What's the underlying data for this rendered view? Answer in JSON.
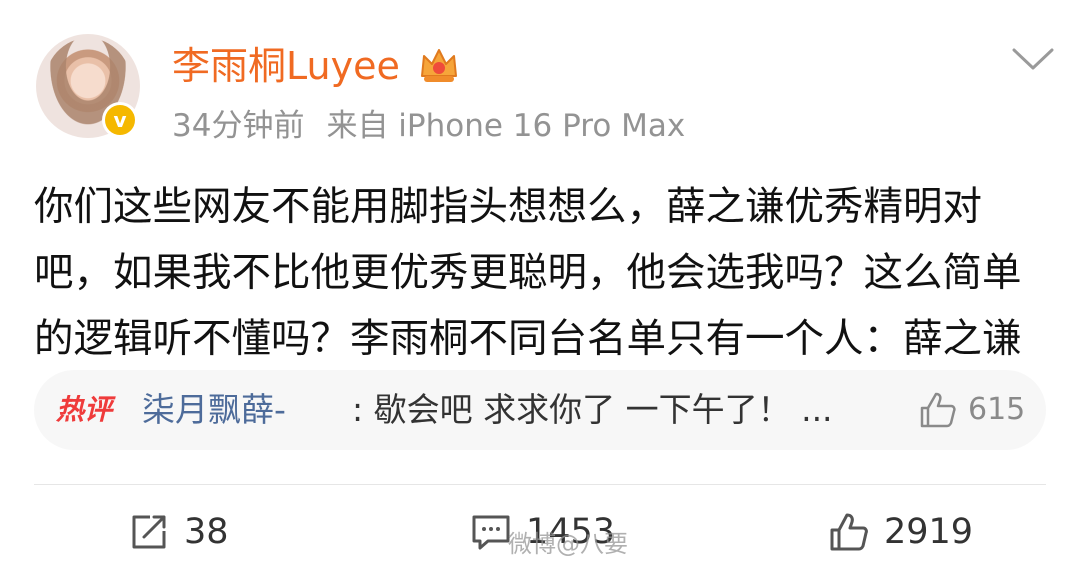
{
  "post": {
    "author": "李雨桐Luyee",
    "time": "34分钟前",
    "source": "来自 iPhone 16 Pro Max",
    "content_lines": [
      "你们这些网友不能用脚指头想想么，薛之谦优秀精明对",
      "吧，如果我不比他更优秀更聪明，他会选我吗？这么简单",
      "的逻辑听不懂吗？李雨桐不同台名单只有一个人：薛之谦"
    ]
  },
  "hot_comment": {
    "badge": "热评",
    "user": "柒月飘薛-",
    "text": ": 歇会吧 求求你了 一下午了！ ...",
    "likes": "615"
  },
  "actions": {
    "reposts": "38",
    "comments": "1453",
    "likes": "2919"
  },
  "watermark": "微博@八要",
  "colors": {
    "author": "#f06a22",
    "meta": "#939393",
    "hot_badge": "#ef3b3b",
    "comment_user": "#4d6b9a",
    "verified": "#f5b800"
  },
  "icons": [
    "chevron-down-icon",
    "crown-icon",
    "verified-icon",
    "thumbs-up-icon",
    "repost-icon",
    "comment-icon"
  ]
}
